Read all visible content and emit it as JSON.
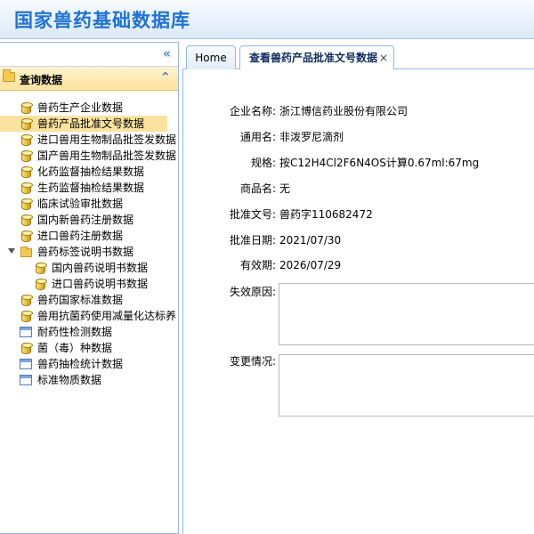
{
  "header": {
    "title": "国家兽药基础数据库"
  },
  "sidebar": {
    "collapse_glyph": "«",
    "section_title": "查询数据",
    "section_glyph": "⌃",
    "items": [
      {
        "label": "兽药生产企业数据",
        "icon": "database-icon"
      },
      {
        "label": "兽药产品批准文号数据",
        "icon": "database-icon",
        "selected": true
      },
      {
        "label": "进口兽用生物制品批签发数据",
        "icon": "database-icon"
      },
      {
        "label": "国产兽用生物制品批签发数据",
        "icon": "database-icon"
      },
      {
        "label": "化药监督抽检结果数据",
        "icon": "database-icon"
      },
      {
        "label": "生药监督抽检结果数据",
        "icon": "database-icon"
      },
      {
        "label": "临床试验审批数据",
        "icon": "database-icon"
      },
      {
        "label": "国内新兽药注册数据",
        "icon": "database-icon"
      },
      {
        "label": "进口兽药注册数据",
        "icon": "database-icon"
      },
      {
        "label": "兽药标签说明书数据",
        "icon": "folder-icon"
      },
      {
        "label": "国内兽药说明书数据",
        "icon": "database-icon"
      },
      {
        "label": "进口兽药说明书数据",
        "icon": "database-icon"
      },
      {
        "label": "兽药国家标准数据",
        "icon": "database-icon"
      },
      {
        "label": "兽用抗菌药使用减量化达标养",
        "icon": "database-icon"
      },
      {
        "label": "耐药性检测数据",
        "icon": "document-icon"
      },
      {
        "label": "菌（毒）种数据",
        "icon": "database-icon"
      },
      {
        "label": "兽药抽检统计数据",
        "icon": "document-icon"
      },
      {
        "label": "标准物质数据",
        "icon": "document-icon"
      }
    ]
  },
  "tabs": {
    "home": "Home",
    "query": "查看兽药产品批准文号数据",
    "close_glyph": "×"
  },
  "form": {
    "fields": [
      {
        "label": "企业名称:",
        "value": "浙江博信药业股份有限公司"
      },
      {
        "label": "通用名:",
        "value": "非泼罗尼滴剂"
      },
      {
        "label": "规格:",
        "value": "按C12H4Cl2F6N4OS计算0.67ml:67mg"
      },
      {
        "label": "商品名:",
        "value": "无"
      },
      {
        "label": "批准文号:",
        "value": "兽药字110682472"
      },
      {
        "label": "批准日期:",
        "value": "2021/07/30"
      },
      {
        "label": "有效期:",
        "value": "2026/07/29"
      }
    ],
    "invalid_reason_label": "失效原因:",
    "change_label": "变更情况:"
  }
}
